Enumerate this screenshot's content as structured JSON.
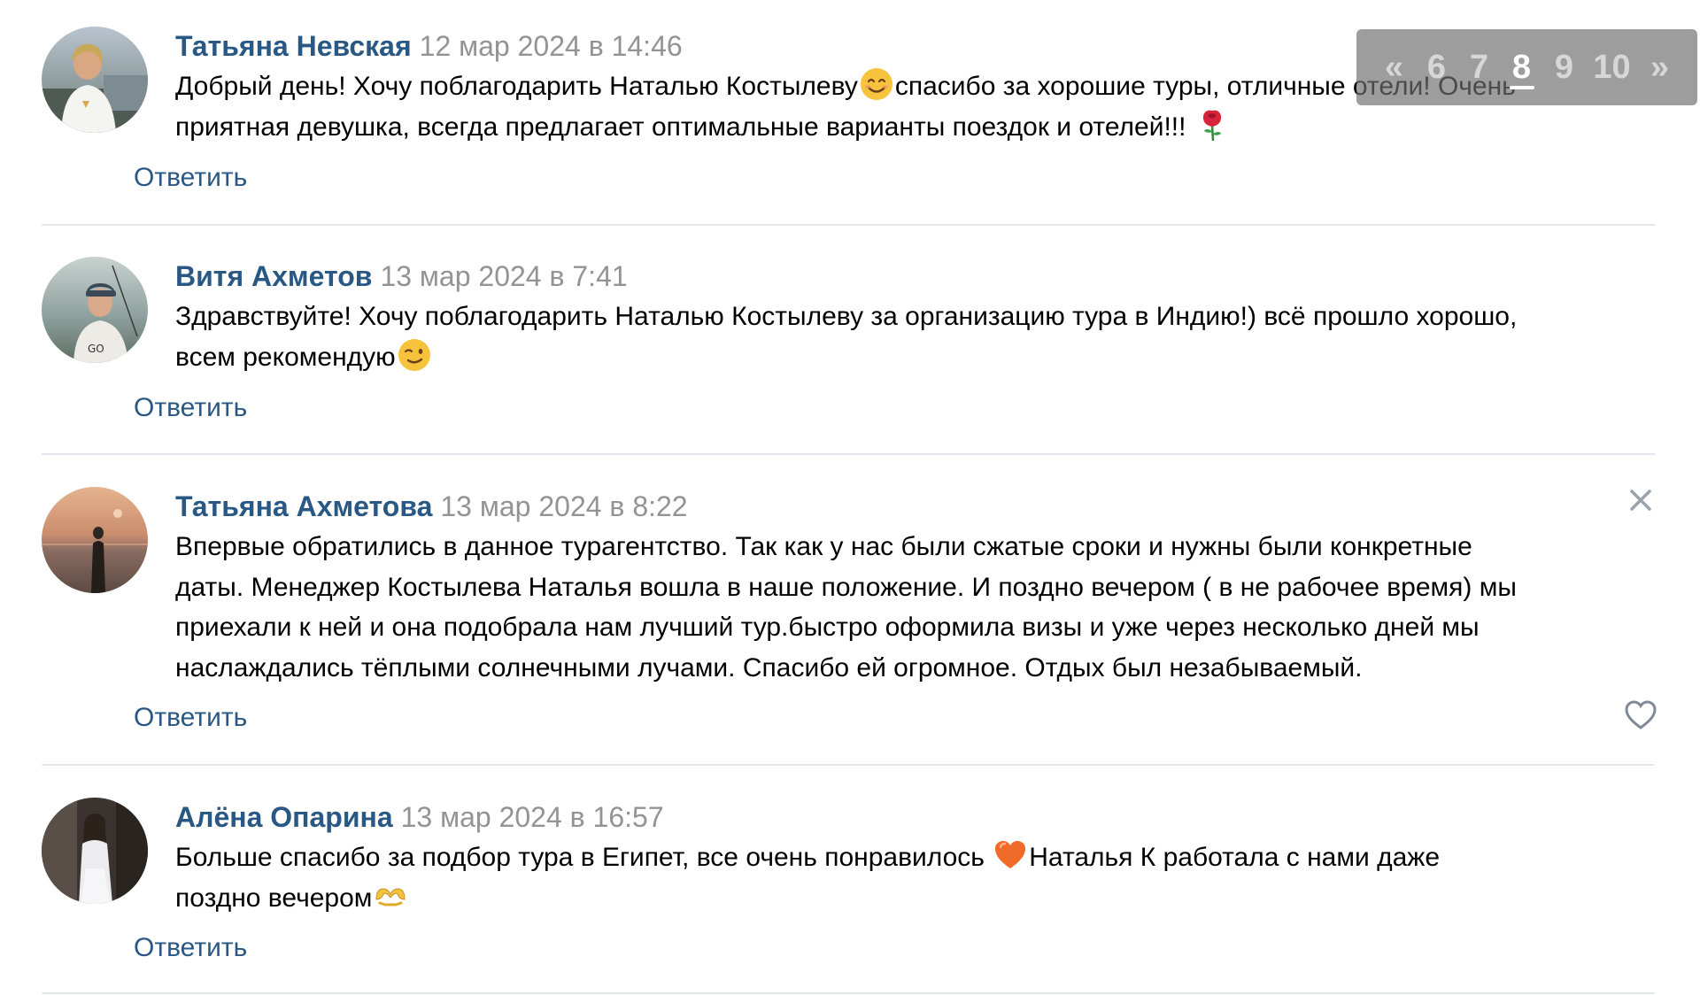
{
  "pager": {
    "prev": "«",
    "pages": [
      "6",
      "7",
      "8",
      "9",
      "10"
    ],
    "current": "8",
    "next": "»"
  },
  "comments": [
    {
      "author": "Татьяна Невская",
      "date": "12 мар 2024 в 14:46",
      "lines": [
        [
          "Добрый день! Хочу поблагодарить Наталью Костылеву",
          {
            "emoji": "smiling-face-emoji"
          },
          "спасибо за хорошие туры, отличные отели! Очень"
        ],
        [
          "приятная девушка, всегда предлагает оптимальные варианты поездок и отелей!!! ",
          {
            "emoji": "rose-emoji"
          }
        ]
      ],
      "reply": "Ответить"
    },
    {
      "author": "Витя Ахметов",
      "date": "13 мар 2024 в 7:41",
      "lines": [
        [
          "Здравствуйте! Хочу поблагодарить Наталью Костылеву за организацию тура в Индию!) всё прошло хорошо,"
        ],
        [
          "всем рекомендую",
          {
            "emoji": "winking-face-emoji"
          }
        ]
      ],
      "reply": "Ответить"
    },
    {
      "author": "Татьяна Ахметова",
      "date": "13 мар 2024 в 8:22",
      "lines": [
        [
          "Впервые обратились в данное турагентство. Так как у нас были сжатые сроки и нужны были конкретные"
        ],
        [
          "даты. Менеджер Костылева Наталья вошла в наше положение. И поздно вечером ( в не рабочее время) мы"
        ],
        [
          "приехали к ней и она подобрала нам лучший тур.быстро оформила визы и уже через несколько дней мы"
        ],
        [
          "наслаждались тёплыми солнечными лучами. Спасибо ей огромное. Отдых был незабываемый."
        ]
      ],
      "reply": "Ответить"
    },
    {
      "author": "Алёна Опарина",
      "date": "13 мар 2024 в 16:57",
      "lines": [
        [
          "Больше спасибо за подбор тура в Египет, все очень понравилось ",
          {
            "emoji": "orange-heart-emoji"
          },
          "Наталья К работала с нами даже"
        ],
        [
          "поздно вечером",
          {
            "emoji": "heart-hands-emoji"
          }
        ]
      ],
      "reply": "Ответить"
    }
  ]
}
